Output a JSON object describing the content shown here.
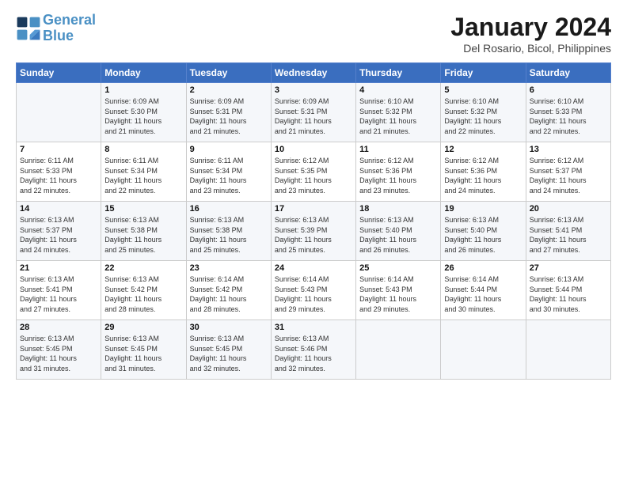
{
  "header": {
    "logo_line1": "General",
    "logo_line2": "Blue",
    "month": "January 2024",
    "location": "Del Rosario, Bicol, Philippines"
  },
  "weekdays": [
    "Sunday",
    "Monday",
    "Tuesday",
    "Wednesday",
    "Thursday",
    "Friday",
    "Saturday"
  ],
  "weeks": [
    [
      {
        "day": "",
        "info": ""
      },
      {
        "day": "1",
        "info": "Sunrise: 6:09 AM\nSunset: 5:30 PM\nDaylight: 11 hours\nand 21 minutes."
      },
      {
        "day": "2",
        "info": "Sunrise: 6:09 AM\nSunset: 5:31 PM\nDaylight: 11 hours\nand 21 minutes."
      },
      {
        "day": "3",
        "info": "Sunrise: 6:09 AM\nSunset: 5:31 PM\nDaylight: 11 hours\nand 21 minutes."
      },
      {
        "day": "4",
        "info": "Sunrise: 6:10 AM\nSunset: 5:32 PM\nDaylight: 11 hours\nand 21 minutes."
      },
      {
        "day": "5",
        "info": "Sunrise: 6:10 AM\nSunset: 5:32 PM\nDaylight: 11 hours\nand 22 minutes."
      },
      {
        "day": "6",
        "info": "Sunrise: 6:10 AM\nSunset: 5:33 PM\nDaylight: 11 hours\nand 22 minutes."
      }
    ],
    [
      {
        "day": "7",
        "info": "Sunrise: 6:11 AM\nSunset: 5:33 PM\nDaylight: 11 hours\nand 22 minutes."
      },
      {
        "day": "8",
        "info": "Sunrise: 6:11 AM\nSunset: 5:34 PM\nDaylight: 11 hours\nand 22 minutes."
      },
      {
        "day": "9",
        "info": "Sunrise: 6:11 AM\nSunset: 5:34 PM\nDaylight: 11 hours\nand 23 minutes."
      },
      {
        "day": "10",
        "info": "Sunrise: 6:12 AM\nSunset: 5:35 PM\nDaylight: 11 hours\nand 23 minutes."
      },
      {
        "day": "11",
        "info": "Sunrise: 6:12 AM\nSunset: 5:36 PM\nDaylight: 11 hours\nand 23 minutes."
      },
      {
        "day": "12",
        "info": "Sunrise: 6:12 AM\nSunset: 5:36 PM\nDaylight: 11 hours\nand 24 minutes."
      },
      {
        "day": "13",
        "info": "Sunrise: 6:12 AM\nSunset: 5:37 PM\nDaylight: 11 hours\nand 24 minutes."
      }
    ],
    [
      {
        "day": "14",
        "info": "Sunrise: 6:13 AM\nSunset: 5:37 PM\nDaylight: 11 hours\nand 24 minutes."
      },
      {
        "day": "15",
        "info": "Sunrise: 6:13 AM\nSunset: 5:38 PM\nDaylight: 11 hours\nand 25 minutes."
      },
      {
        "day": "16",
        "info": "Sunrise: 6:13 AM\nSunset: 5:38 PM\nDaylight: 11 hours\nand 25 minutes."
      },
      {
        "day": "17",
        "info": "Sunrise: 6:13 AM\nSunset: 5:39 PM\nDaylight: 11 hours\nand 25 minutes."
      },
      {
        "day": "18",
        "info": "Sunrise: 6:13 AM\nSunset: 5:40 PM\nDaylight: 11 hours\nand 26 minutes."
      },
      {
        "day": "19",
        "info": "Sunrise: 6:13 AM\nSunset: 5:40 PM\nDaylight: 11 hours\nand 26 minutes."
      },
      {
        "day": "20",
        "info": "Sunrise: 6:13 AM\nSunset: 5:41 PM\nDaylight: 11 hours\nand 27 minutes."
      }
    ],
    [
      {
        "day": "21",
        "info": "Sunrise: 6:13 AM\nSunset: 5:41 PM\nDaylight: 11 hours\nand 27 minutes."
      },
      {
        "day": "22",
        "info": "Sunrise: 6:13 AM\nSunset: 5:42 PM\nDaylight: 11 hours\nand 28 minutes."
      },
      {
        "day": "23",
        "info": "Sunrise: 6:14 AM\nSunset: 5:42 PM\nDaylight: 11 hours\nand 28 minutes."
      },
      {
        "day": "24",
        "info": "Sunrise: 6:14 AM\nSunset: 5:43 PM\nDaylight: 11 hours\nand 29 minutes."
      },
      {
        "day": "25",
        "info": "Sunrise: 6:14 AM\nSunset: 5:43 PM\nDaylight: 11 hours\nand 29 minutes."
      },
      {
        "day": "26",
        "info": "Sunrise: 6:14 AM\nSunset: 5:44 PM\nDaylight: 11 hours\nand 30 minutes."
      },
      {
        "day": "27",
        "info": "Sunrise: 6:13 AM\nSunset: 5:44 PM\nDaylight: 11 hours\nand 30 minutes."
      }
    ],
    [
      {
        "day": "28",
        "info": "Sunrise: 6:13 AM\nSunset: 5:45 PM\nDaylight: 11 hours\nand 31 minutes."
      },
      {
        "day": "29",
        "info": "Sunrise: 6:13 AM\nSunset: 5:45 PM\nDaylight: 11 hours\nand 31 minutes."
      },
      {
        "day": "30",
        "info": "Sunrise: 6:13 AM\nSunset: 5:45 PM\nDaylight: 11 hours\nand 32 minutes."
      },
      {
        "day": "31",
        "info": "Sunrise: 6:13 AM\nSunset: 5:46 PM\nDaylight: 11 hours\nand 32 minutes."
      },
      {
        "day": "",
        "info": ""
      },
      {
        "day": "",
        "info": ""
      },
      {
        "day": "",
        "info": ""
      }
    ]
  ]
}
